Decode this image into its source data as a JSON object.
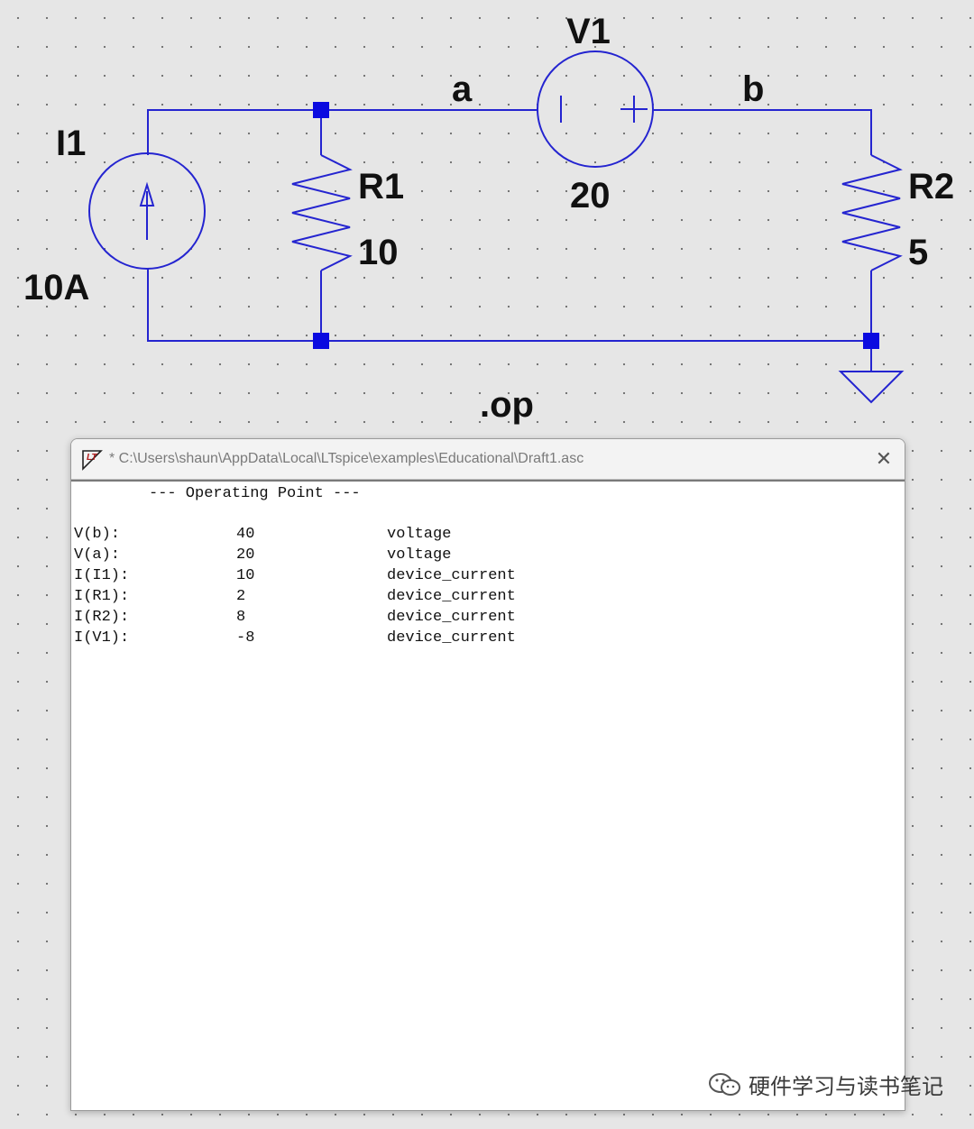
{
  "schematic": {
    "components": [
      {
        "id": "I1",
        "label": "I1",
        "value": "10A",
        "type": "current-source"
      },
      {
        "id": "R1",
        "label": "R1",
        "value": "10",
        "type": "resistor"
      },
      {
        "id": "V1",
        "label": "V1",
        "value": "20",
        "type": "voltage-source"
      },
      {
        "id": "R2",
        "label": "R2",
        "value": "5",
        "type": "resistor"
      }
    ],
    "nets": [
      "a",
      "b"
    ],
    "directive": ".op",
    "colors": {
      "wire": "#2424d0",
      "node": "#0a0ae0",
      "background": "#e6e6e6"
    }
  },
  "window": {
    "title": "* C:\\Users\\shaun\\AppData\\Local\\LTspice\\examples\\Educational\\Draft1.asc",
    "close_icon": "close-icon",
    "heading": "--- Operating Point ---",
    "rows": [
      {
        "name": "V(b):",
        "value": "40",
        "type": "voltage"
      },
      {
        "name": "V(a):",
        "value": "20",
        "type": "voltage"
      },
      {
        "name": "I(I1):",
        "value": "10",
        "type": "device_current"
      },
      {
        "name": "I(R1):",
        "value": "2",
        "type": "device_current"
      },
      {
        "name": "I(R2):",
        "value": "8",
        "type": "device_current"
      },
      {
        "name": "I(V1):",
        "value": "-8",
        "type": "device_current"
      }
    ]
  },
  "watermark": {
    "text": "硬件学习与读书笔记"
  }
}
